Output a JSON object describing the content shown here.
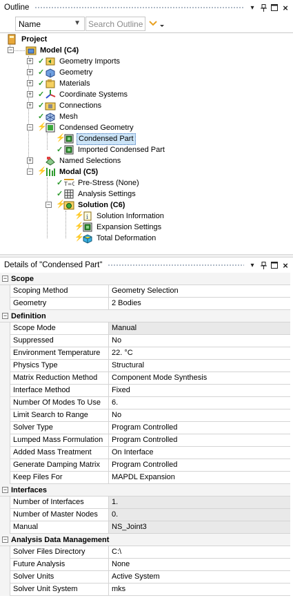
{
  "outline": {
    "title": "Outline",
    "sort_select": "Name",
    "search_placeholder": "Search Outline"
  },
  "tree": [
    {
      "label": "Project",
      "icon": "project-icon",
      "bold": true
    },
    {
      "label": "Model (C4)",
      "icon": "model-icon",
      "bold": true
    },
    {
      "label": "Geometry Imports",
      "icon": "geometry-imports-icon"
    },
    {
      "label": "Geometry",
      "icon": "geometry-icon"
    },
    {
      "label": "Materials",
      "icon": "materials-icon"
    },
    {
      "label": "Coordinate Systems",
      "icon": "coordinate-systems-icon"
    },
    {
      "label": "Connections",
      "icon": "connections-icon"
    },
    {
      "label": "Mesh",
      "icon": "mesh-icon"
    },
    {
      "label": "Condensed Geometry",
      "icon": "condensed-geometry-icon"
    },
    {
      "label": "Condensed Part",
      "icon": "condensed-part-icon",
      "selected": true
    },
    {
      "label": "Imported Condensed Part",
      "icon": "imported-condensed-part-icon"
    },
    {
      "label": "Named Selections",
      "icon": "named-selections-icon"
    },
    {
      "label": "Modal (C5)",
      "icon": "modal-icon",
      "bold": true
    },
    {
      "label": "Pre-Stress (None)",
      "icon": "pre-stress-icon"
    },
    {
      "label": "Analysis Settings",
      "icon": "analysis-settings-icon"
    },
    {
      "label": "Solution (C6)",
      "icon": "solution-icon",
      "bold": true
    },
    {
      "label": "Solution Information",
      "icon": "solution-information-icon"
    },
    {
      "label": "Expansion Settings",
      "icon": "expansion-settings-icon"
    },
    {
      "label": "Total Deformation",
      "icon": "total-deformation-icon"
    }
  ],
  "details": {
    "title": "Details of \"Condensed Part\"",
    "sections": [
      {
        "name": "Scope",
        "rows": [
          {
            "key": "Scoping Method",
            "value": "Geometry Selection"
          },
          {
            "key": "Geometry",
            "value": "2 Bodies"
          }
        ]
      },
      {
        "name": "Definition",
        "rows": [
          {
            "key": "Scope Mode",
            "value": "Manual"
          },
          {
            "key": "Suppressed",
            "value": "No"
          },
          {
            "key": "Environment Temperature",
            "value": "22. °C"
          },
          {
            "key": "Physics Type",
            "value": "Structural"
          },
          {
            "key": "Matrix Reduction Method",
            "value": "Component Mode Synthesis"
          },
          {
            "key": "Interface Method",
            "value": "Fixed"
          },
          {
            "key": "Number Of Modes To Use",
            "value": "6."
          },
          {
            "key": "Limit Search to Range",
            "value": "No"
          },
          {
            "key": "Solver Type",
            "value": "Program Controlled"
          },
          {
            "key": "Lumped Mass Formulation",
            "value": "Program Controlled"
          },
          {
            "key": "Added Mass Treatment",
            "value": "On Interface"
          },
          {
            "key": "Generate Damping Matrix",
            "value": "Program Controlled"
          },
          {
            "key": "Keep Files For",
            "value": "MAPDL Expansion"
          }
        ]
      },
      {
        "name": "Interfaces",
        "rows": [
          {
            "key": "Number of Interfaces",
            "value": "1."
          },
          {
            "key": "Number of Master Nodes",
            "value": "0."
          },
          {
            "key": "Manual",
            "value": "NS_Joint3"
          }
        ]
      },
      {
        "name": "Analysis Data Management",
        "rows": [
          {
            "key": "Solver Files Directory",
            "value": "C:\\"
          },
          {
            "key": "Future Analysis",
            "value": "None"
          },
          {
            "key": "Solver Units",
            "value": "Active System"
          },
          {
            "key": "Solver Unit System",
            "value": "mks"
          }
        ]
      }
    ]
  }
}
